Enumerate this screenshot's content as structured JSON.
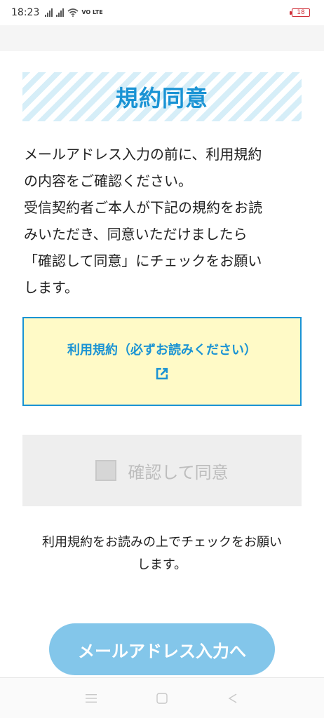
{
  "status_bar": {
    "time": "18:23",
    "network_label": "VO LTE",
    "battery_level": "18"
  },
  "page": {
    "title": "規約同意",
    "description_lines": [
      "メールアドレス入力の前に、利用規約",
      "の内容をご確認ください。",
      "受信契約者ご本人が下記の規約をお読",
      "みいただき、同意いただけましたら",
      "「確認して同意」にチェックをお願い",
      "します。"
    ],
    "terms_link_label": "利用規約（必ずお読みください）",
    "confirm_label": "確認して同意",
    "note_lines": [
      "利用規約をお読みの上でチェックをお願い",
      "します。"
    ],
    "next_button_label": "メールアドレス入力へ"
  },
  "colors": {
    "accent": "#1a93d4",
    "terms_bg": "#fffac7",
    "button_bg": "#83c6ea",
    "disabled_bg": "#eeeeee"
  },
  "icons": {
    "external_link": "external-link-icon",
    "nav_menu": "menu-icon",
    "nav_home": "home-icon",
    "nav_back": "back-icon"
  }
}
